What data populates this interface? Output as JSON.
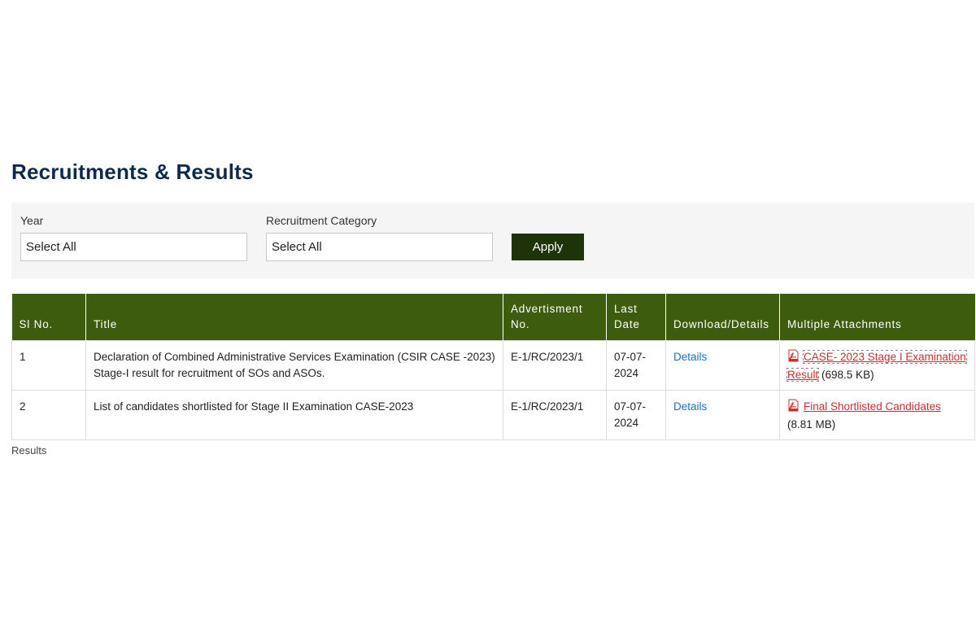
{
  "header": {
    "title": "Recruitments & Results"
  },
  "filters": {
    "year": {
      "label": "Year",
      "value": "Select All"
    },
    "category": {
      "label": "Recruitment Category",
      "value": "Select All"
    },
    "apply_label": "Apply"
  },
  "table": {
    "columns": {
      "sl_no": "Sl No.",
      "title": "Title",
      "adv_no": "Advertisment No.",
      "last_date": "Last Date",
      "download": "Download/Details",
      "attachments": "Multiple Attachments"
    },
    "rows": [
      {
        "sl_no": "1",
        "title": "Declaration of Combined Administrative Services Examination (CSIR CASE -2023) Stage-I result for recruitment of SOs and ASOs.",
        "adv_no": "E-1/RC/2023/1",
        "last_date": "07-07-2024",
        "details_label": "Details",
        "attachment_label": "CASE- 2023 Stage I Examination Result",
        "attachment_size": "(698.5 KB)"
      },
      {
        "sl_no": "2",
        "title": "List of candidates shortlisted for Stage II Examination CASE-2023",
        "adv_no": "E-1/RC/2023/1",
        "last_date": "07-07-2024",
        "details_label": "Details",
        "attachment_label": "Final Shortlisted Candidates",
        "attachment_size": "(8.81 MB)"
      }
    ]
  },
  "footer": {
    "text": "Results"
  },
  "colors": {
    "title": "#0f2a4d",
    "header_bg": "#3e5c0d",
    "apply_bg": "#1c3408",
    "link": "#1a6fc9",
    "attachment_link": "#d12b2b"
  }
}
